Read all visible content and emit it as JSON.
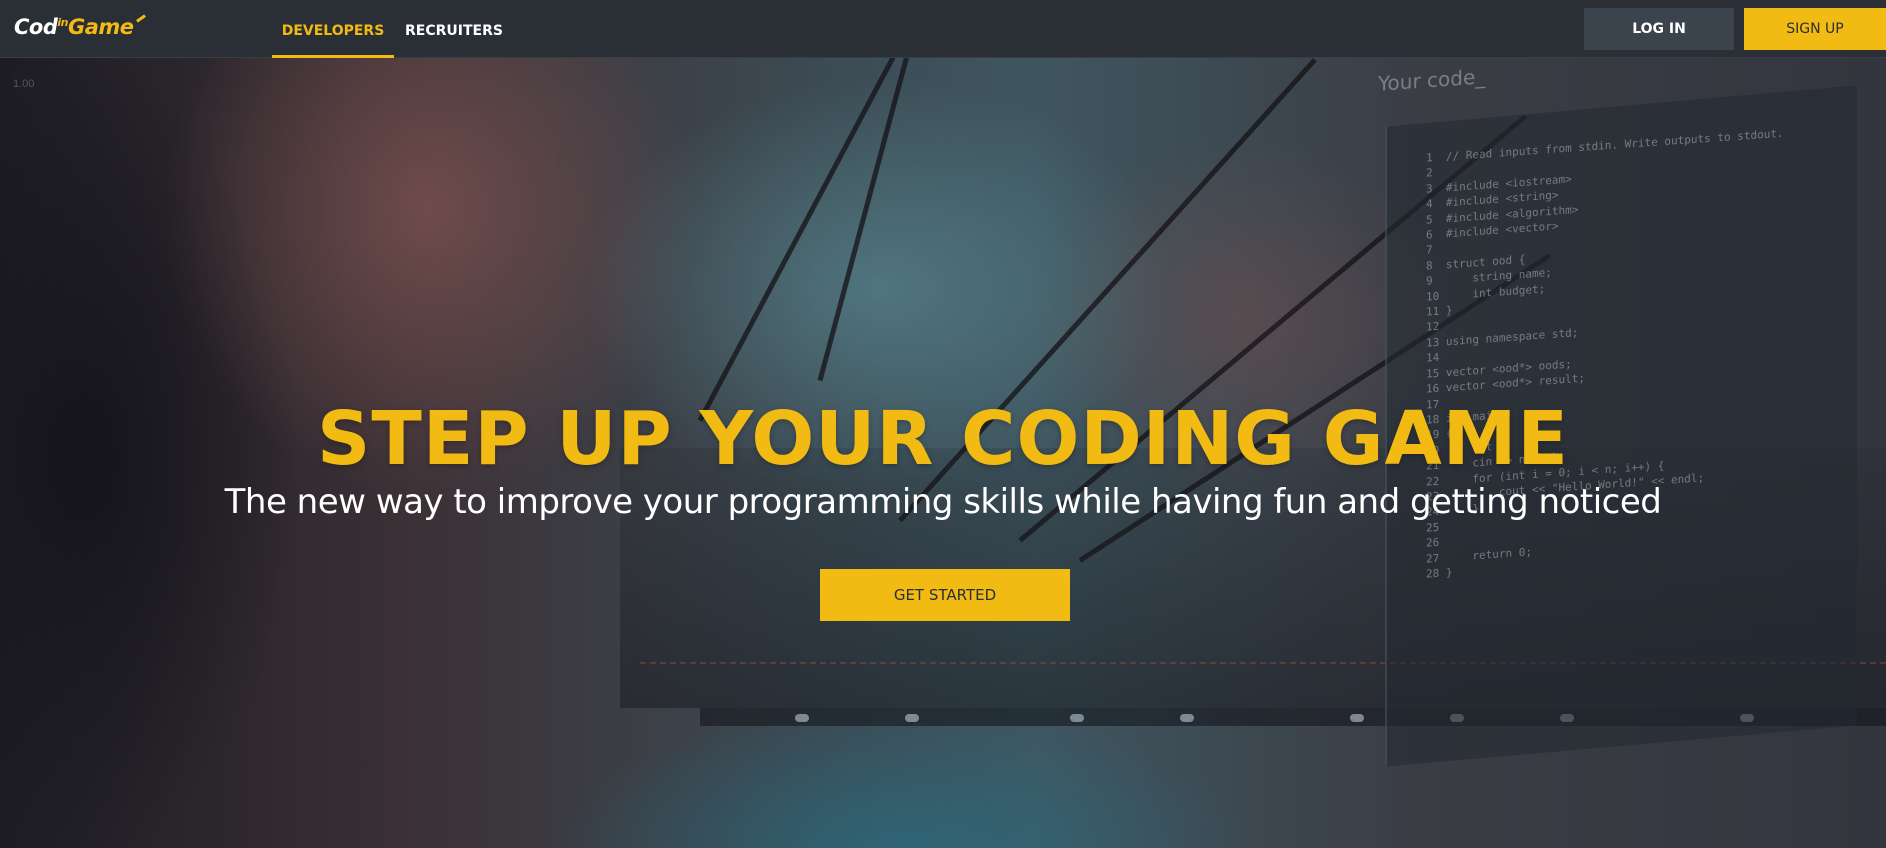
{
  "header": {
    "logo_prefix": "Cod",
    "logo_in": "in",
    "logo_game": "Game",
    "tabs": [
      {
        "label": "DEVELOPERS",
        "active": true
      },
      {
        "label": "RECRUITERS",
        "active": false
      }
    ],
    "login_label": "LOG IN",
    "signup_label": "SIGN UP"
  },
  "zoom_indicator": "1.00",
  "hero": {
    "headline": "STEP UP YOUR CODING GAME",
    "subheadline": "The new way to improve your programming skills while having fun and getting noticed",
    "cta_label": "GET STARTED",
    "code_panel_title": "Your code_",
    "code_lines": "1  // Read inputs from stdin. Write outputs to stdout.\n2\n3  #include <iostream>\n4  #include <string>\n5  #include <algorithm>\n6  #include <vector>\n7\n8  struct ood {\n9      string name;\n10     int budget;\n11 }\n12\n13 using namespace std;\n14\n15 vector <ood*> oods;\n16 vector <ood*> result;\n17\n18 int main()\n19 {\n20     int n;\n21     cin >> n >> k;\n22     for (int i = 0; i < n; i++) {\n23         cout << \"Hello World!\" << endl;\n24     }\n25\n26\n27     return 0;\n28 }"
  },
  "colors": {
    "accent": "#f2bb13",
    "header_bg": "#2a2e35",
    "login_bg": "#3b434c"
  }
}
